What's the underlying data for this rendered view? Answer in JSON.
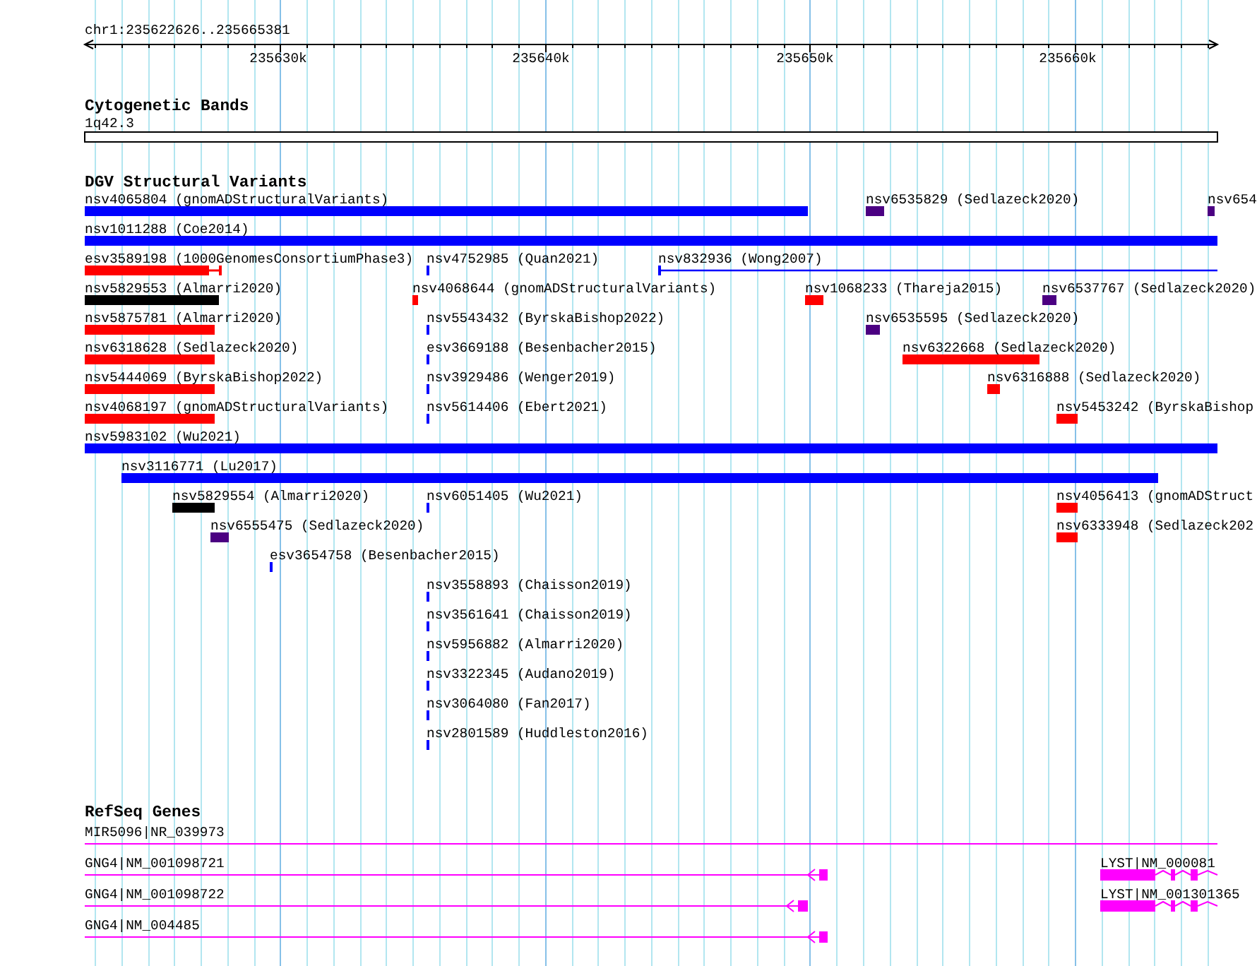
{
  "location": "chr1:235622626..235665381",
  "ruler": {
    "ticks": [
      {
        "label": "235630k"
      },
      {
        "label": "235640k"
      },
      {
        "label": "235650k"
      },
      {
        "label": "235660k"
      }
    ]
  },
  "tracks": [
    {
      "kind": "bands",
      "title": "Cytogenetic Bands",
      "features": [
        {
          "label": "1q42.3"
        }
      ]
    },
    {
      "kind": "variants",
      "title": "DGV Structural Variants",
      "rows": [
        [
          {
            "label": "nsv4065804 (gnomADStructuralVariants)",
            "kind": "bar",
            "color": "#0000ff"
          },
          {
            "label": "nsv6535829 (Sedlazeck2020)",
            "kind": "bar",
            "color": "#4b0082"
          },
          {
            "label": "nsv654",
            "kind": "bar",
            "color": "#4b0082"
          }
        ],
        [
          {
            "label": "nsv1011288 (Coe2014)",
            "kind": "bar",
            "color": "#0000ff"
          }
        ],
        [
          {
            "label": "esv3589198 (1000GenomesConsortiumPhase3)",
            "kind": "capped",
            "color": "#ff0000"
          },
          {
            "label": "nsv4752985 (Quan2021)",
            "kind": "bar",
            "color": "#0000ff"
          },
          {
            "label": "nsv832936 (Wong2007)",
            "kind": "line",
            "color": "#0000ff"
          }
        ],
        [
          {
            "label": "nsv5829553 (Almarri2020)",
            "kind": "bar",
            "color": "#000000"
          },
          {
            "label": "nsv4068644 (gnomADStructuralVariants)",
            "kind": "bar",
            "color": "#ff0000"
          },
          {
            "label": "nsv1068233 (Thareja2015)",
            "kind": "bar",
            "color": "#ff0000"
          },
          {
            "label": "nsv6537767 (Sedlazeck2020)",
            "kind": "bar",
            "color": "#4b0082"
          }
        ],
        [
          {
            "label": "nsv5875781 (Almarri2020)",
            "kind": "bar",
            "color": "#ff0000"
          },
          {
            "label": "nsv5543432 (ByrskaBishop2022)",
            "kind": "bar",
            "color": "#0000ff"
          },
          {
            "label": "nsv6535595 (Sedlazeck2020)",
            "kind": "bar",
            "color": "#4b0082"
          }
        ],
        [
          {
            "label": "nsv6318628 (Sedlazeck2020)",
            "kind": "bar",
            "color": "#ff0000"
          },
          {
            "label": "esv3669188 (Besenbacher2015)",
            "kind": "bar",
            "color": "#0000ff"
          },
          {
            "label": "nsv6322668 (Sedlazeck2020)",
            "kind": "bar",
            "color": "#ff0000"
          }
        ],
        [
          {
            "label": "nsv5444069 (ByrskaBishop2022)",
            "kind": "bar",
            "color": "#ff0000"
          },
          {
            "label": "nsv3929486 (Wenger2019)",
            "kind": "bar",
            "color": "#0000ff"
          },
          {
            "label": "nsv6316888 (Sedlazeck2020)",
            "kind": "bar",
            "color": "#ff0000"
          }
        ],
        [
          {
            "label": "nsv4068197 (gnomADStructuralVariants)",
            "kind": "bar",
            "color": "#ff0000"
          },
          {
            "label": "nsv5614406 (Ebert2021)",
            "kind": "bar",
            "color": "#0000ff"
          },
          {
            "label": "nsv5453242 (ByrskaBishop",
            "kind": "bar",
            "color": "#ff0000"
          }
        ],
        [
          {
            "label": "nsv5983102 (Wu2021)",
            "kind": "bar",
            "color": "#0000ff"
          }
        ],
        [
          {
            "label": "nsv3116771 (Lu2017)",
            "kind": "bar",
            "color": "#0000ff"
          }
        ],
        [
          {
            "label": "nsv5829554 (Almarri2020)",
            "kind": "bar",
            "color": "#000000"
          },
          {
            "label": "nsv6051405 (Wu2021)",
            "kind": "bar",
            "color": "#0000ff"
          },
          {
            "label": "nsv4056413 (gnomADStruct",
            "kind": "bar",
            "color": "#ff0000"
          }
        ],
        [
          {
            "label": "nsv6555475 (Sedlazeck2020)",
            "kind": "bar",
            "color": "#4b0082"
          },
          {
            "label": "nsv6333948 (Sedlazeck202",
            "kind": "bar",
            "color": "#ff0000"
          }
        ],
        [
          {
            "label": "esv3654758 (Besenbacher2015)",
            "kind": "bar",
            "color": "#0000ff"
          }
        ],
        [
          {
            "label": "nsv3558893 (Chaisson2019)",
            "kind": "bar",
            "color": "#0000ff"
          }
        ],
        [
          {
            "label": "nsv3561641 (Chaisson2019)",
            "kind": "bar",
            "color": "#0000ff"
          }
        ],
        [
          {
            "label": "nsv5956882 (Almarri2020)",
            "kind": "bar",
            "color": "#0000ff"
          }
        ],
        [
          {
            "label": "nsv3322345 (Audano2019)",
            "kind": "bar",
            "color": "#0000ff"
          }
        ],
        [
          {
            "label": "nsv3064080 (Fan2017)",
            "kind": "bar",
            "color": "#0000ff"
          }
        ],
        [
          {
            "label": "nsv2801589 (Huddleston2016)",
            "kind": "bar",
            "color": "#0000ff"
          }
        ]
      ]
    },
    {
      "kind": "genes",
      "title": "RefSeq Genes",
      "rows": [
        [
          {
            "label": "MIR5096|NR_039973"
          }
        ],
        [
          {
            "label": "GNG4|NM_001098721",
            "strand_arrow": true
          },
          {
            "label": "LYST|NM_000081",
            "strand_arrow": false
          }
        ],
        [
          {
            "label": "GNG4|NM_001098722",
            "strand_arrow": true
          },
          {
            "label": "LYST|NM_001301365",
            "strand_arrow": false
          }
        ],
        [
          {
            "label": "GNG4|NM_004485",
            "strand_arrow": true
          }
        ]
      ]
    }
  ]
}
